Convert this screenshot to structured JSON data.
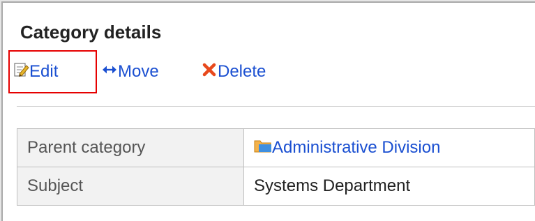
{
  "header": {
    "title": "Category details"
  },
  "toolbar": {
    "edit_label": "Edit",
    "move_label": "Move",
    "delete_label": "Delete"
  },
  "details": {
    "rows": [
      {
        "label": "Parent category",
        "value": "Administrative Division",
        "is_link": true,
        "icon": "folder-icon"
      },
      {
        "label": "Subject",
        "value": "Systems Department",
        "is_link": false
      }
    ]
  },
  "colors": {
    "link": "#1a4fd1",
    "highlight": "#e60000",
    "label_bg": "#f2f2f2",
    "delete_icon": "#e8491d",
    "edit_icon": "#e7b52b",
    "folder_icon": "#f4b24a"
  },
  "icons": [
    "edit-icon",
    "move-arrows-icon",
    "delete-x-icon",
    "folder-icon"
  ]
}
